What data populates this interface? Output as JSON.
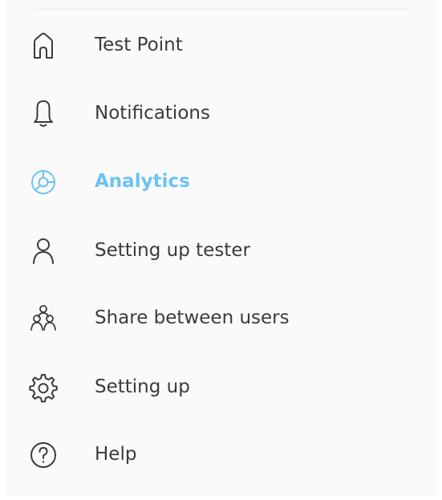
{
  "colors": {
    "text": "#3b3b3b",
    "icon": "#3b3b3b",
    "active": "#6ec2f3",
    "background": "#fafafa"
  },
  "nav": {
    "active_item": "Analytics",
    "items": [
      {
        "label": "Test Point",
        "icon": "home-icon"
      },
      {
        "label": "Notifications",
        "icon": "bell-icon"
      },
      {
        "label": "Analytics",
        "icon": "analytics-icon"
      },
      {
        "label": "Setting up tester",
        "icon": "user-icon"
      },
      {
        "label": "Share between users",
        "icon": "users-icon"
      },
      {
        "label": "Setting up",
        "icon": "gear-icon"
      },
      {
        "label": "Help",
        "icon": "help-icon"
      }
    ]
  }
}
